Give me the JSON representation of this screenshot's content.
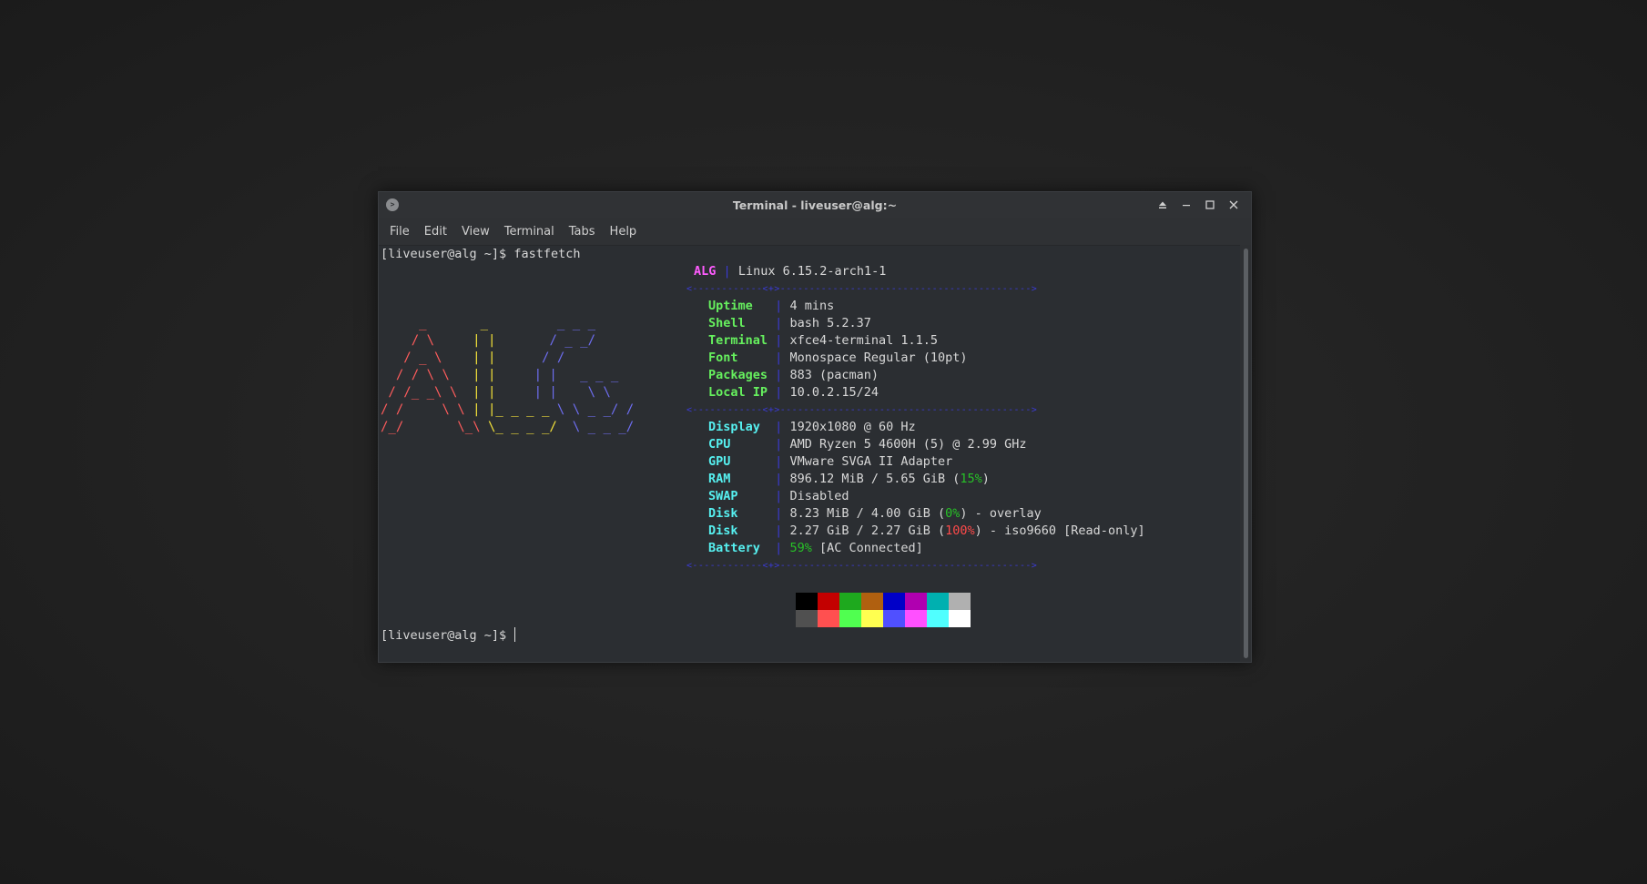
{
  "window": {
    "title": "Terminal - liveuser@alg:~",
    "app_icon": "terminal-icon",
    "buttons": [
      "eject-icon",
      "minimize-icon",
      "maximize-icon",
      "close-icon"
    ]
  },
  "menubar": {
    "items": [
      "File",
      "Edit",
      "View",
      "Terminal",
      "Tabs",
      "Help"
    ]
  },
  "terminal": {
    "prompt": "[liveuser@alg ~]$ ",
    "command": "fastfetch",
    "final_prompt": "[liveuser@alg ~]$ ",
    "logo": {
      "lines": [
        {
          "red": "     _     ",
          "yel": "  _        ",
          "blu": " _ _ _ "
        },
        {
          "red": "    / \\    ",
          "yel": " | |       ",
          "blu": "/ _ _/ "
        },
        {
          "red": "   / _ \\   ",
          "yel": " | |      ",
          "blu": "/ /   "
        },
        {
          "red": "  / / \\ \\  ",
          "yel": " | |     ",
          "blu": "| |   _ _ _ "
        },
        {
          "red": " / /_ _\\ \\ ",
          "yel": " | |     ",
          "blu": "| |    \\ \\ "
        },
        {
          "red": "/ /     \\ \\",
          "yel": " | |_ _ _ _ ",
          "blu": "\\ \\ _ _/ / "
        },
        {
          "red": "/_/       \\_\\",
          "yel": " \\_ _ _ _/ ",
          "blu": " \\ _ _ _/ "
        }
      ]
    },
    "header": {
      "name": "ALG",
      "value": "Linux 6.15.2-arch1-1"
    },
    "separator": "<------------<+>------------------------------------------->",
    "info_group1": [
      {
        "key": "Uptime",
        "value": "4 mins"
      },
      {
        "key": "Shell",
        "value": "bash 5.2.37"
      },
      {
        "key": "Terminal",
        "value": "xfce4-terminal 1.1.5"
      },
      {
        "key": "Font",
        "value": "Monospace Regular (10pt)"
      },
      {
        "key": "Packages",
        "value": "883 (pacman)"
      },
      {
        "key": "Local IP",
        "value": "10.0.2.15/24"
      }
    ],
    "info_group2": [
      {
        "key": "Display",
        "value": "1920x1080 @ 60 Hz"
      },
      {
        "key": "CPU",
        "value": "AMD Ryzen 5 4600H (5) @ 2.99 GHz"
      },
      {
        "key": "GPU",
        "value": "VMware SVGA II Adapter"
      },
      {
        "key": "RAM",
        "pre": "896.12 MiB / 5.65 GiB (",
        "pct": "15%",
        "post": ")"
      },
      {
        "key": "SWAP",
        "value": "Disabled"
      },
      {
        "key": "Disk",
        "pre": "8.23 MiB / 4.00 GiB (",
        "pct": "0%",
        "post": ") - overlay"
      },
      {
        "key": "Disk",
        "pre": "2.27 GiB / 2.27 GiB (",
        "pct": "100%",
        "post": ") - iso9660 [Read-only]"
      },
      {
        "key": "Battery",
        "pct": "59%",
        "post": " [AC Connected]"
      }
    ],
    "palette_top": [
      "#000000",
      "#c30000",
      "#1ea91e",
      "#b06010",
      "#0000c8",
      "#b000b0",
      "#00b0b0",
      "#b0b0b0"
    ],
    "palette_bottom": [
      "#505050",
      "#ff5050",
      "#50ff50",
      "#ffff50",
      "#5050ff",
      "#ff50ff",
      "#50ffff",
      "#ffffff"
    ]
  }
}
